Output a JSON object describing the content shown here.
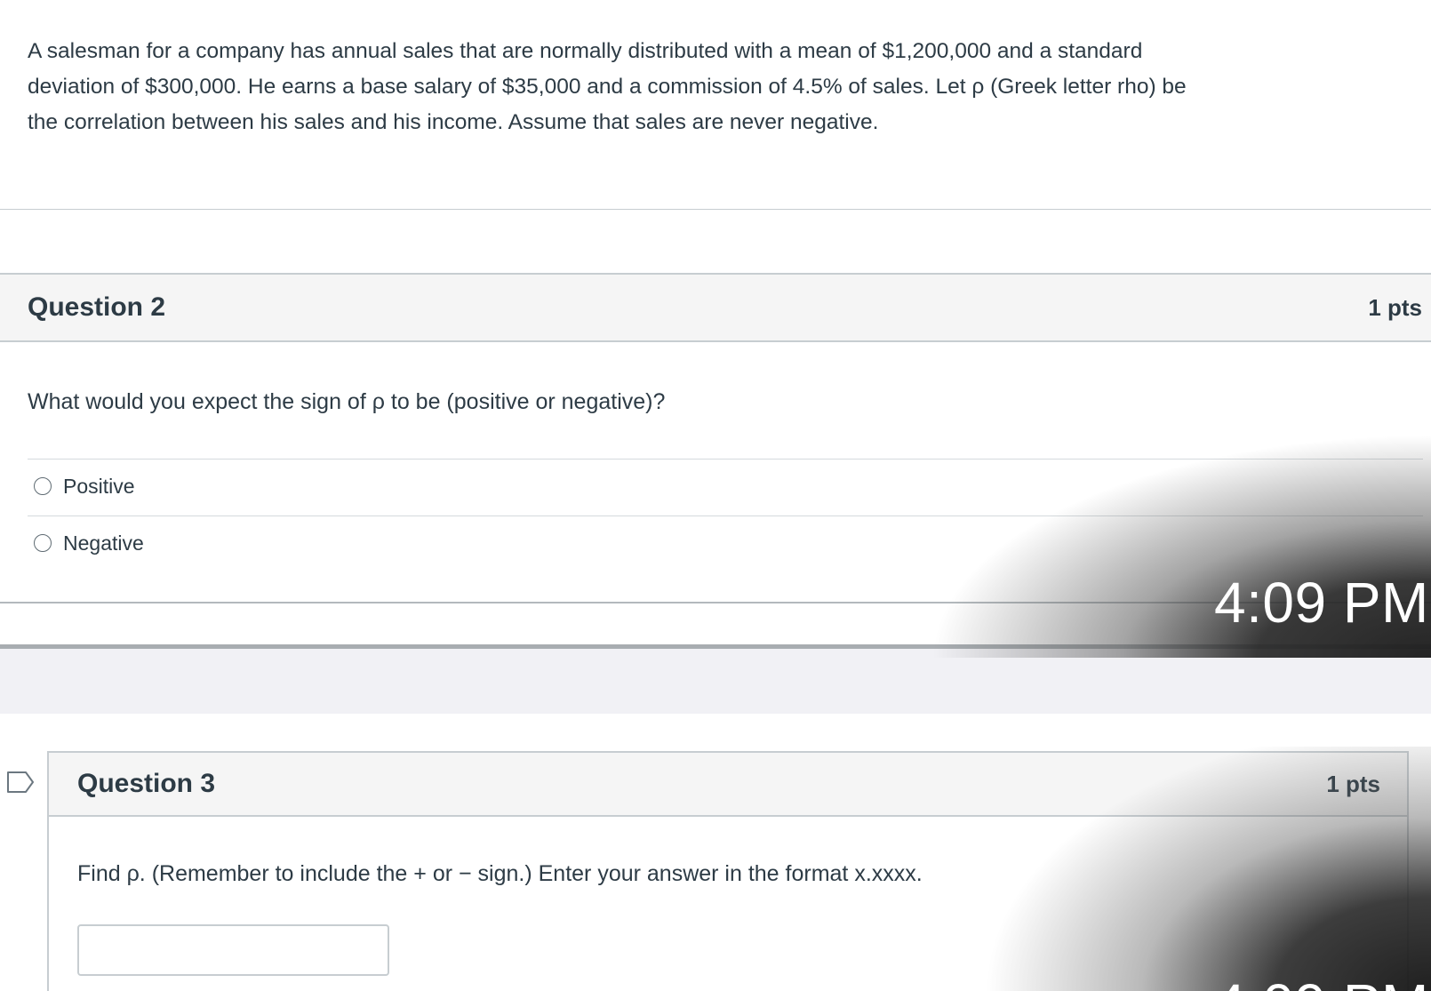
{
  "intro": {
    "text": "A salesman for a company has annual sales that are normally distributed with a mean of $1,200,000 and a standard\ndeviation of $300,000. He earns a base salary of $35,000 and a commission of 4.5% of sales. Let ρ (Greek letter rho) be\nthe correlation between his sales and his income. Assume that sales are never negative."
  },
  "question2": {
    "title": "Question 2",
    "points": "1 pts",
    "text": "What would you expect the sign of ρ to be (positive or negative)?",
    "options": [
      {
        "label": "Positive"
      },
      {
        "label": "Negative"
      }
    ]
  },
  "question3": {
    "title": "Question 3",
    "points": "1 pts",
    "text": "Find ρ. (Remember to include the + or − sign.)  Enter your answer in the format x.xxxx.",
    "answer_value": "",
    "flag_icon": "bookmark-flag-icon"
  },
  "notification": {
    "time": "4:09 PM",
    "time_partial": "4:09 PM"
  }
}
